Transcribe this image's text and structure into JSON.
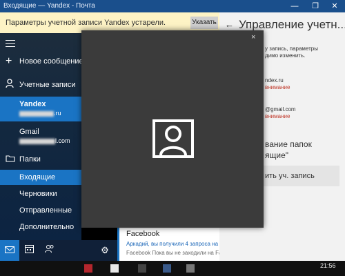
{
  "window": {
    "title": "Входящие — Yandex - Почта",
    "controls": [
      "—",
      "❐",
      "✕"
    ]
  },
  "notice": {
    "message": "Параметры учетной записи Yandex устарели.",
    "button": "Указать"
  },
  "sidebar": {
    "new_message": "Новое сообщение",
    "accounts_header": "Учетные записи",
    "accounts": [
      {
        "name": "Yandex",
        "email_tail": ".ru"
      },
      {
        "name": "Gmail",
        "email_tail": "l.com"
      }
    ],
    "folders_header": "Папки",
    "folders": [
      "Входящие",
      "Черновики",
      "Отправленные",
      "Дополнительно"
    ]
  },
  "mail_list": {
    "from": "Facebook",
    "subject": "Аркадий, вы получили 4 запроса на",
    "preview": "Facebook Пока вы не заходили на Fa"
  },
  "panel": {
    "title": "Управление учетн...",
    "desc_line1": "у запись, параметры",
    "desc_line2": "димо изменить.",
    "account1_tail": "ndex.ru",
    "account1_warning": "внимание",
    "account2_tail": "@gmail.com",
    "account2_warning": "внимание",
    "link_line1": "вание папок",
    "link_line2": "ящие\"",
    "add_account": "ить уч. запись"
  },
  "modal": {
    "close": "×",
    "avatar_icon": "person-icon"
  },
  "taskbar": {
    "clock": "21:56"
  },
  "colors": {
    "accent": "#1a74c4",
    "titlebar": "#1a4f8c",
    "notice_bg": "#fdf3c5",
    "modal_bg": "#3b3b3b",
    "warning": "#c0392b"
  }
}
